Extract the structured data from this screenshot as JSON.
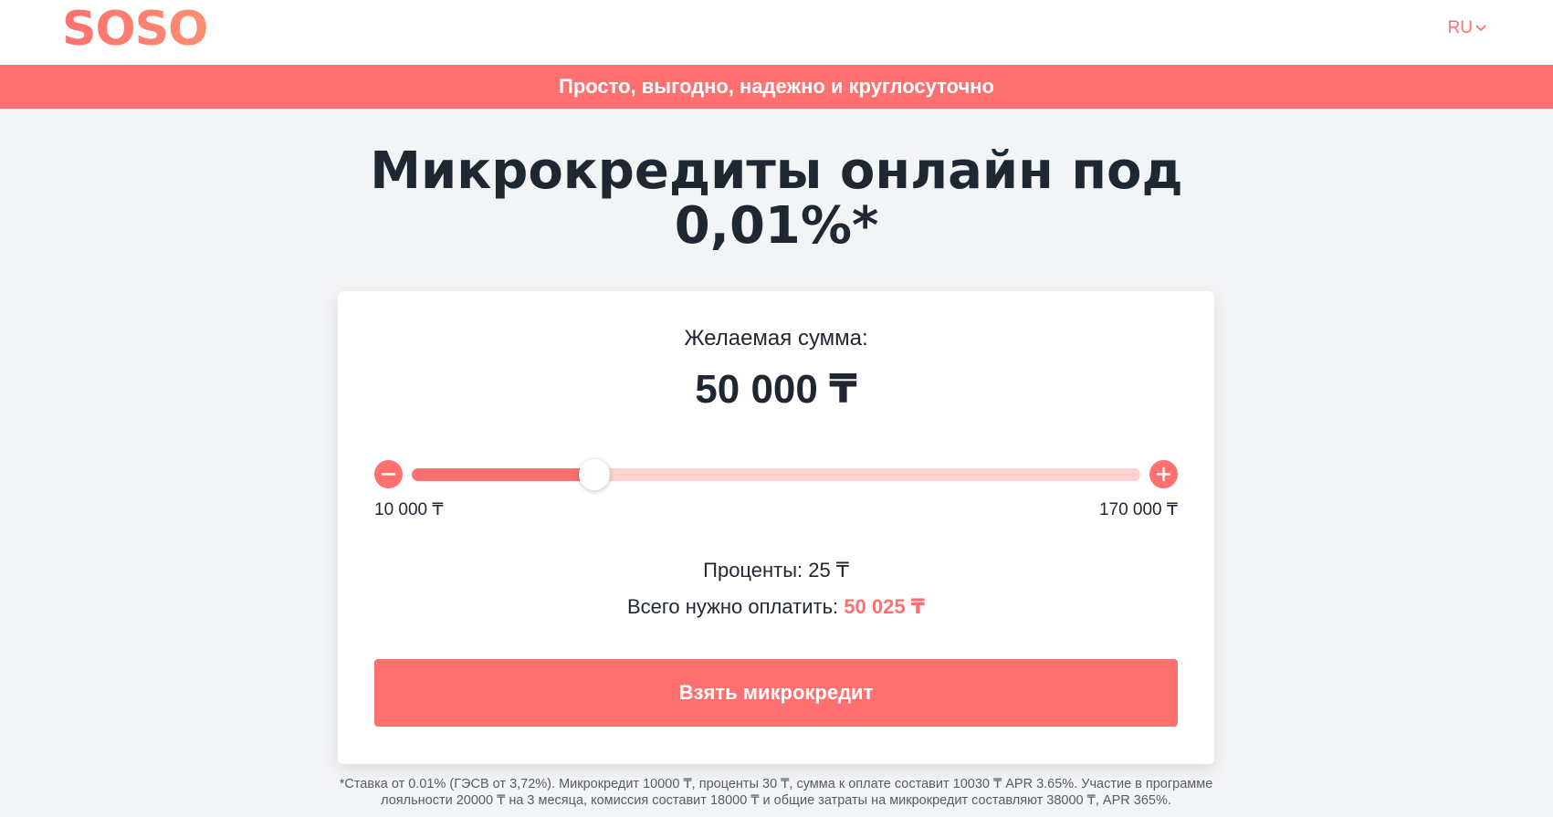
{
  "header": {
    "logo_text": "SOSO",
    "language": "RU",
    "language_icon": "chevron-down-icon"
  },
  "banner": {
    "text": "Просто, выгодно, надежно и круглосуточно"
  },
  "hero": {
    "title_line1": "Микрокредиты онлайн под",
    "title_line2": "0,01%*"
  },
  "calculator": {
    "sum_label": "Желаемая сумма:",
    "sum_value": "50 000 ₸",
    "slider": {
      "min_label": "10 000 ₸",
      "max_label": "170 000 ₸",
      "min": 10000,
      "max": 170000,
      "value": 50000,
      "minus_icon": "minus-icon",
      "plus_icon": "plus-icon"
    },
    "interest_text": "Проценты: 25 ₸",
    "total_prefix": "Всего нужно оплатить:",
    "total_value": "50 025 ₸",
    "cta_label": "Взять микрокредит"
  },
  "footnote": {
    "line1": "*Ставка от 0.01% (ГЭСВ от 3,72%). Микрокредит 10000 ₸, проценты 30 ₸, сумма к оплате составит 10030 ₸ APR 3.65%. Участие в программе",
    "line2": "лояльности 20000 ₸ на 3 месяца, комиссия составит 18000 ₸ и общие затраты на микрокредит составляют 38000 ₸, APR 365%."
  },
  "colors": {
    "accent": "#ff7070",
    "track": "#ffd1d1",
    "text": "#1f2733",
    "background": "#f3f4f6"
  }
}
